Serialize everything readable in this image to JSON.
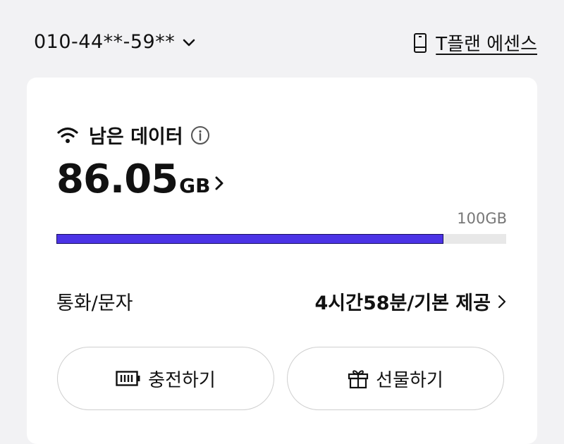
{
  "header": {
    "phone_number": "010-44**-59**",
    "plan_name": "T플랜 에센스"
  },
  "data_usage": {
    "title": "남은 데이터",
    "remaining_value": "86.05",
    "remaining_unit": "GB",
    "total_label": "100GB",
    "remaining_fraction": 0.8605,
    "bar_color": "#4b33e6"
  },
  "calls": {
    "label": "통화/문자",
    "value": "4시간58분/기본 제공"
  },
  "buttons": {
    "charge_label": "충전하기",
    "gift_label": "선물하기"
  },
  "icons": [
    "chevron-down-icon",
    "phone-device-icon",
    "wifi-icon",
    "info-icon",
    "chevron-right-icon",
    "battery-charge-icon",
    "gift-icon"
  ]
}
